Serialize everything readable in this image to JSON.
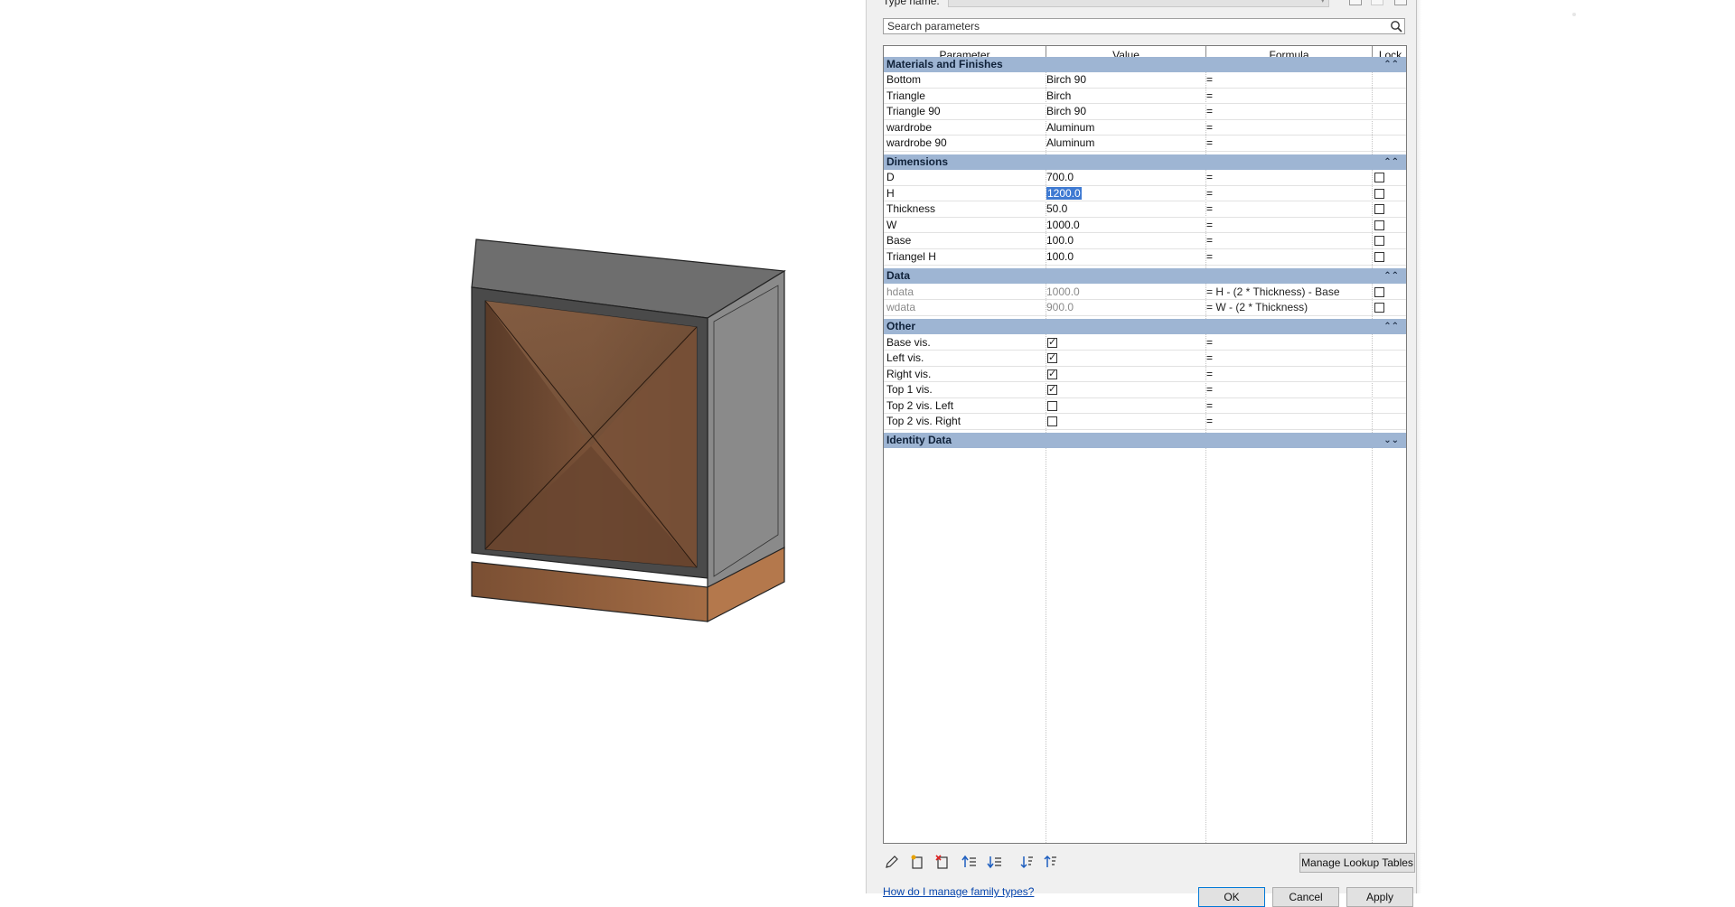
{
  "dialog": {
    "type_name_label": "Type name:",
    "search_placeholder": "Search parameters",
    "columns": {
      "parameter": "Parameter",
      "value": "Value",
      "formula": "Formula",
      "lock": "Lock"
    },
    "sections": {
      "materials": {
        "title": "Materials and Finishes",
        "rows": [
          {
            "parameter": "Bottom",
            "value": "Birch 90",
            "formula": "="
          },
          {
            "parameter": "Triangle",
            "value": "Birch",
            "formula": "="
          },
          {
            "parameter": "Triangle 90",
            "value": "Birch 90",
            "formula": "="
          },
          {
            "parameter": "wardrobe",
            "value": "Aluminum",
            "formula": "="
          },
          {
            "parameter": "wardrobe 90",
            "value": "Aluminum",
            "formula": "="
          }
        ]
      },
      "dimensions": {
        "title": "Dimensions",
        "rows": [
          {
            "parameter": "D",
            "value": "700.0",
            "formula": "=",
            "lock": false
          },
          {
            "parameter": "H",
            "value": "1200.0",
            "formula": "=",
            "lock": false,
            "selected": true
          },
          {
            "parameter": "Thickness",
            "value": "50.0",
            "formula": "=",
            "lock": false
          },
          {
            "parameter": "W",
            "value": "1000.0",
            "formula": "=",
            "lock": false
          },
          {
            "parameter": "Base",
            "value": "100.0",
            "formula": "=",
            "lock": false
          },
          {
            "parameter": "Triangel H",
            "value": "100.0",
            "formula": "=",
            "lock": false
          }
        ]
      },
      "data": {
        "title": "Data",
        "rows": [
          {
            "parameter": "hdata",
            "value": "1000.0",
            "formula": "= H - (2 * Thickness) - Base",
            "lock": false
          },
          {
            "parameter": "wdata",
            "value": "900.0",
            "formula": "= W - (2 * Thickness)",
            "lock": false
          }
        ]
      },
      "other": {
        "title": "Other",
        "rows": [
          {
            "parameter": "Base vis.",
            "checked": true,
            "formula": "="
          },
          {
            "parameter": "Left vis.",
            "checked": true,
            "formula": "="
          },
          {
            "parameter": "Right vis.",
            "checked": true,
            "formula": "="
          },
          {
            "parameter": "Top 1 vis.",
            "checked": true,
            "formula": "="
          },
          {
            "parameter": "Top 2 vis. Left",
            "checked": false,
            "formula": "="
          },
          {
            "parameter": "Top 2 vis. Right",
            "checked": false,
            "formula": "="
          }
        ]
      },
      "identity": {
        "title": "Identity Data"
      }
    },
    "manage_lookup_label": "Manage Lookup Tables",
    "help_link": "How do I manage family types?",
    "ok_label": "OK",
    "cancel_label": "Cancel",
    "apply_label": "Apply",
    "icons": [
      "pencil-icon",
      "new-parameter-icon",
      "delete-parameter-icon",
      "move-up-icon",
      "move-down-icon",
      "sort-ascending-icon",
      "sort-descending-icon"
    ],
    "colors": {
      "section_header": "#9eb5d3",
      "selection": "#3f7ad2",
      "link": "#0645ad"
    }
  }
}
